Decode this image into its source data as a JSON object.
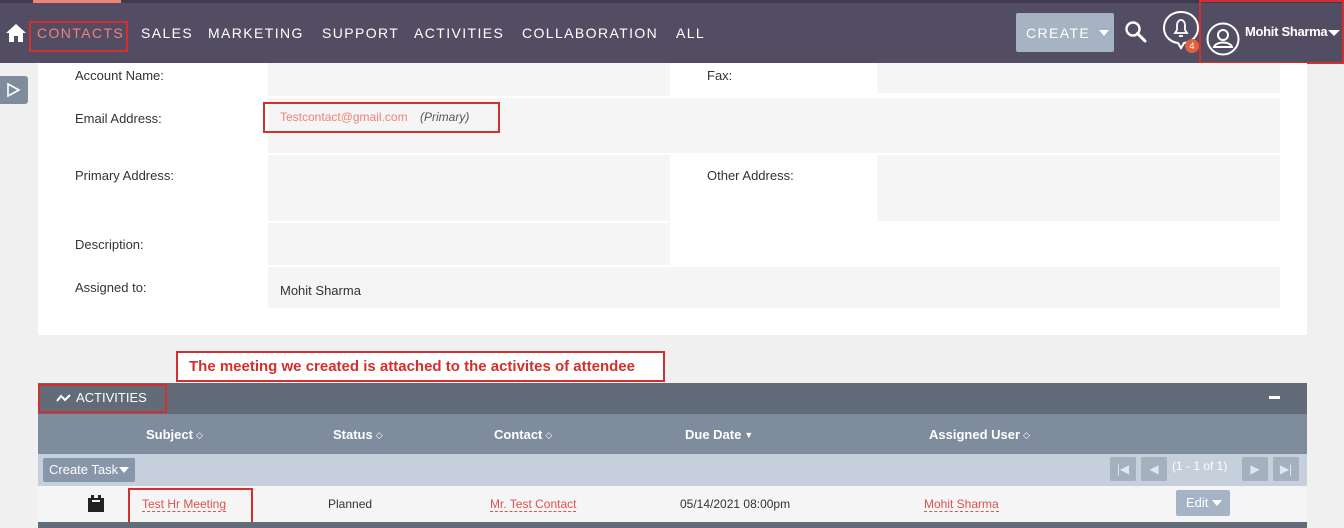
{
  "nav": {
    "items": [
      "CONTACTS",
      "SALES",
      "MARKETING",
      "SUPPORT",
      "ACTIVITIES",
      "COLLABORATION",
      "ALL"
    ],
    "create_label": "CREATE",
    "notification_count": "4",
    "user_name": "Mohit Sharma"
  },
  "detail": {
    "labels": {
      "account_name": "Account Name:",
      "fax": "Fax:",
      "email": "Email Address:",
      "primary_address": "Primary Address:",
      "other_address": "Other Address:",
      "description": "Description:",
      "assigned_to": "Assigned to:"
    },
    "email_value": "Testcontact@gmail.com",
    "email_tag": "(Primary)",
    "assigned_to_value": "Mohit Sharma"
  },
  "annotation": "The meeting we created is attached to the activites of attendee",
  "activities": {
    "title": "ACTIVITIES",
    "columns": [
      "Subject",
      "Status",
      "Contact",
      "Due Date",
      "Assigned User"
    ],
    "create_task_label": "Create Task",
    "pagination": "(1 - 1 of 1)",
    "rows": [
      {
        "subject": "Test Hr Meeting",
        "status": "Planned",
        "contact": "Mr. Test Contact",
        "due_date": "05/14/2021 08:00pm",
        "assigned_user": "Mohit Sharma",
        "action_label": "Edit"
      }
    ]
  },
  "icons": [
    "home-icon",
    "search-icon",
    "bell-icon",
    "user-avatar-icon",
    "sidebar-toggle-icon",
    "activities-icon",
    "collapse-icon",
    "meeting-icon",
    "sort-icon",
    "pager-first-icon",
    "pager-prev-icon",
    "pager-next-icon",
    "pager-last-icon"
  ],
  "colors": {
    "nav_bg": "#534d64",
    "accent": "#f08377",
    "annotation_red": "#d32f2f",
    "panel_header": "#626b78",
    "column_header": "#7f8c9e"
  }
}
